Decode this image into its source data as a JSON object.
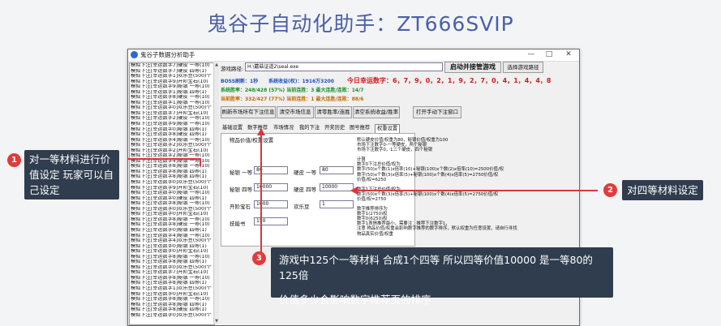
{
  "title": "鬼谷子自动化助手：ZT666SVIP",
  "window": {
    "title": "鬼谷子数据分析助手",
    "minimize": "—",
    "maximize": "□",
    "close": "✕"
  },
  "list_rows": [
    "模拟下注[幸运数字7]硬皮 一等(10)",
    "模拟下注[幸运数字7]硬皮 四等(1)",
    "模拟下注[幸运数字1]欢乐豆(500)个",
    "模拟下注[幸运数字9]开阶宝石(10)",
    "模拟下注[幸运数字9]秘银 一等(10)",
    "模拟下注[幸运数字1]秘银 四等(1)",
    "模拟下注[幸运数字8]硬皮 一等(10)",
    "模拟下注[幸运数字1]秘银 一等(10)",
    "模拟下注[幸运数字0]欢乐豆(500)个",
    "模拟下注[幸运数字7]开阶宝石(10)",
    "模拟下注[幸运数字2]硬皮 一等(10)",
    "模拟下注[幸运数字9]秘银 一等(10)",
    "模拟下注[幸运数字0]秘银 四等(1)",
    "模拟下注[幸运数字8]硬皮 四等(1)",
    "模拟下注[幸运数字4]秘银 一等(10)",
    "模拟下注[幸运数字2]欢乐豆(500)个",
    "模拟下注[幸运数字2]开阶宝石(10)",
    "模拟下注[幸运数字2]秘银 一等(10)",
    "模拟下注[幸运数字4]秘银 一等(10)",
    "模拟下注[幸运数字8]秘银 一等(10)",
    "模拟下注[幸运数字8]秘银 四等(1)",
    "模拟下注[幸运数字8]秘银 四等(1)",
    "模拟下注[幸运数字0]欢乐豆(500)个",
    "模拟下注[幸运数字9]开阶宝石(10)",
    "模拟下注[幸运数字0]秘银 一等(10)",
    "模拟下注[幸运数字0]硬皮 四等(1)",
    "模拟下注[幸运数字8]秘银 一等(10)",
    "模拟下注[幸运数字0]欢乐豆(500)个",
    "模拟下注[幸运数字0]开阶宝石(10)",
    "模拟下注[幸运数字8]秘银 一等(10)",
    "模拟下注[幸运数字8]硬皮 一等(10)",
    "模拟下注[幸运数字0]秘银 四等(1)",
    "模拟下注[幸运数字4]秘银 一等(10)",
    "模拟下注[幸运数字4]欢乐豆(500)个",
    "模拟下注[幸运数字0]秘银 四等(1)",
    "模拟下注[幸运数字0]开阶宝石(10)",
    "模拟下注[幸运数字8]秘银 一等(10)",
    "模拟下注[幸运数字8]秘银 四等(1)",
    "模拟下注[幸运数字0]欢乐豆(500)个",
    "模拟下注[幸运数字7]开阶宝石(10)",
    "模拟下注[幸运数字8]秘银 一等(10)",
    "模拟下注[幸运数字8]秘银 四等(1)",
    "模拟下注[幸运数字1]欢乐豆(500)个",
    "模拟下注[幸运数字0]开阶宝石(10)",
    "模拟下注[幸运数字8]秘银 一等(10)",
    "模拟下注[幸运数字8]秘银 四等(1)",
    "模拟下注[幸运数字8]硬皮 四等(1)",
    "模拟下注[幸运数字0]欢乐豆(500)个"
  ],
  "path": {
    "label": "游戏路径:",
    "value": "H:\\蘑菇证道2\\seal.exe",
    "start_button": "启动并接管游戏",
    "select_button": "选择游戏路径"
  },
  "stats": {
    "line1_a": "BOSS刷新：1秒",
    "line1_b": "系统收益(权)：1916万3200",
    "lucky": "今日幸运数字：6，7，9，0，2，1，9，2，7，0，4，1，4，4，8",
    "line2": "系统胜率：248/428 (57%) 当前连胜：3 最大连胜/连败：14/7",
    "line3": "当前胜率：332/427 (77%) 当前连胜：1 最大连胜/连败：88/6"
  },
  "buttons": {
    "refresh": "刷新市场所有下注信息",
    "clear_market": "清空市场信息",
    "clear_rate": "清零胜率/连胜",
    "clear_profit": "清空系统收益/胜率",
    "open_window": "打开手动下注窗口"
  },
  "tabs": [
    "基础设置",
    "数字推荐",
    "市场情况",
    "我的下注",
    "开奖历史",
    "图号推荐",
    "权重设置"
  ],
  "content": {
    "header": "物品价值/权重设置",
    "fields": [
      {
        "label": "秘银 一等",
        "value": "80"
      },
      {
        "label": "硬皮 一等",
        "value": "80"
      },
      {
        "label": "秘银 四等",
        "value": "10000"
      },
      {
        "label": "硬皮 四等",
        "value": "10000"
      },
      {
        "label": "开阶宝石",
        "value": "1000"
      },
      {
        "label": "欢乐豆",
        "value": "1"
      },
      {
        "label": "技能书",
        "value": "150"
      }
    ]
  },
  "description": [
    "默认硬皮价值/权重为80，秘银价值/权重为100",
    "市场下注数字0-一等硬皮，两个秘银",
    "市场下注数字0，1三个硬皮，四个秘银",
    "",
    "计算",
    "数字0下注总价值/权为",
    "数字(50)x个数(1)x倍率(10)+秘银(100)x个数(2)x倍率(10)=2500价值/权",
    "数字(50)x个数(3)x倍率(5)+秘银(100)x个数(4)x倍率(5)=2750价值/权",
    "价值/权=6250",
    "",
    "数字1下注总价值/权为",
    "数字(50)x个数(3)x倍率(5)+秘银(100)x个数(4)x倍率(5)=2750价值/权",
    "价值/权=2750",
    "",
    "数字推荐排序为",
    "数字1(2750)权",
    "数字0(6250)权",
    "数字1表情推荐最小，需要注：推荐下注数字1，",
    "注意 物品价值/权重会影响数字推荐的数字排序，默认权重为任意设置，请自行寻找",
    "物品真实价值/权重"
  ],
  "callouts": {
    "c1_num": "1",
    "c1_text": "对一等材料进行价值设定 玩家可以自己设定",
    "c2_num": "2",
    "c2_text": "对四等材料设定",
    "c3_num": "3",
    "c3_line1": "游戏中125个一等材料 合成1个四等 所以四等价值10000 是一等80的125倍",
    "c3_line2": "价值多少会影响数字推荐页的排序"
  },
  "colors": {
    "title": "#4a5fa8",
    "callout_bg": "#2f3d4e",
    "badge": "#e23b3b",
    "arrow": "#d9363e",
    "lucky": "#d41a1a"
  }
}
